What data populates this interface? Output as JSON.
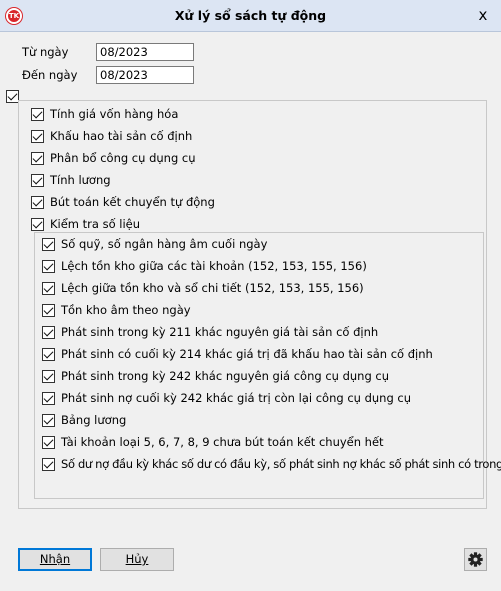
{
  "window": {
    "title": "Xử lý sổ sách tự động",
    "close_glyph": "x",
    "app_icon_text": "TK",
    "icon": "app-logo-icon"
  },
  "form": {
    "from_label": "Từ ngày",
    "from_value": "08/2023",
    "to_label": "Đến ngày",
    "to_value": "08/2023"
  },
  "master": {
    "checked": true
  },
  "tasks": [
    {
      "label": "Tính giá vốn hàng hóa",
      "checked": true
    },
    {
      "label": "Khấu hao tài sản cố định",
      "checked": true
    },
    {
      "label": "Phân bổ công cụ dụng cụ",
      "checked": true
    },
    {
      "label": "Tính lương",
      "checked": true
    },
    {
      "label": "Bút toán kết chuyển tự động",
      "checked": true
    },
    {
      "label": "Kiểm tra số liệu",
      "checked": true
    }
  ],
  "checks": [
    {
      "label": "Số quỹ, số ngân hàng âm cuối ngày",
      "checked": true
    },
    {
      "label": "Lệch tồn kho giữa các tài khoản (152, 153, 155, 156)",
      "checked": true
    },
    {
      "label": "Lệch giữa tồn kho và sổ chi tiết (152, 153, 155, 156)",
      "checked": true
    },
    {
      "label": "Tồn kho âm theo ngày",
      "checked": true
    },
    {
      "label": "Phát sinh trong kỳ 211 khác nguyên giá tài sản cố định",
      "checked": true
    },
    {
      "label": "Phát sinh có cuối kỳ 214 khác giá trị đã khấu hao tài sản cố định",
      "checked": true
    },
    {
      "label": "Phát sinh trong kỳ 242 khác nguyên giá công cụ dụng cụ",
      "checked": true
    },
    {
      "label": "Phát sinh nợ cuối kỳ 242 khác giá trị còn lại công cụ dụng cụ",
      "checked": true
    },
    {
      "label": "Bảng lương",
      "checked": true
    },
    {
      "label": "Tài khoản loại 5, 6, 7, 8, 9 chưa bút toán kết chuyển hết",
      "checked": true
    },
    {
      "label": "Số dư nợ đầu kỳ khác số dư có đầu kỳ, số phát sinh nợ khác số phát sinh có trong kỳ",
      "checked": true
    }
  ],
  "buttons": {
    "ok_label": "Nhận",
    "cancel_label": "Hủy",
    "settings_icon": "gear-icon"
  },
  "colors": {
    "accent": "#0078d7",
    "titlebar": "#dce5f3",
    "logo": "#d9262b"
  }
}
